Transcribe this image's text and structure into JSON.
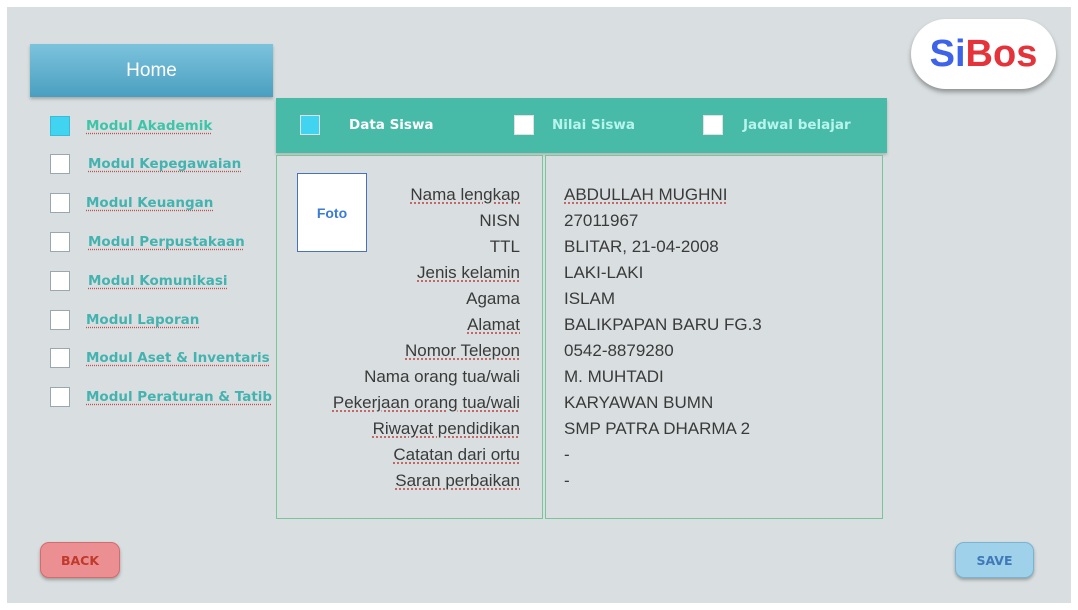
{
  "header": {
    "home_label": "Home"
  },
  "logo": {
    "part1": "Si",
    "part2": "Bos"
  },
  "sidebar": {
    "items": [
      {
        "label": "Modul Akademik",
        "active": true
      },
      {
        "label": "Modul Kepegawaian",
        "active": false
      },
      {
        "label": "Modul Keuangan",
        "active": false
      },
      {
        "label": "Modul Perpustakaan",
        "active": false
      },
      {
        "label": "Modul Komunikasi",
        "active": false
      },
      {
        "label": "Modul Laporan",
        "active": false
      },
      {
        "label": "Modul Aset & Inventaris",
        "active": false
      },
      {
        "label": "Modul Peraturan & Tatib",
        "active": false
      }
    ]
  },
  "tabs": [
    {
      "label": "Data Siswa",
      "active": true
    },
    {
      "label": "Nilai Siswa",
      "active": false
    },
    {
      "label": "Jadwal belajar",
      "active": false
    }
  ],
  "profile": {
    "photo_label": "Foto",
    "labels": [
      "Nama lengkap",
      "NISN",
      "TTL",
      "Jenis kelamin",
      "Agama",
      "Alamat",
      "Nomor Telepon",
      "Nama orang tua/wali",
      "Pekerjaan orang tua/wali",
      "Riwayat pendidikan",
      "Catatan dari ortu",
      "Saran perbaikan"
    ],
    "values": [
      "ABDULLAH MUGHNI",
      "27011967",
      "BLITAR, 21-04-2008",
      "LAKI-LAKI",
      "ISLAM",
      "BALIKPAPAN BARU FG.3",
      "0542-8879280",
      "M. MUHTADI",
      "KARYAWAN BUMN",
      "SMP PATRA DHARMA 2",
      "-",
      "-"
    ]
  },
  "buttons": {
    "back": "BACK",
    "save": "SAVE"
  },
  "colors": {
    "background": "#d9dfe0",
    "tab_bar": "#47bba8",
    "header_gradient_top": "#7cc3dd",
    "active_checkbox": "#40d4f0",
    "back_button": "#ec8f92",
    "save_button": "#9fd1ea",
    "logo_blue": "#3d63e8",
    "logo_red": "#e4333b"
  }
}
